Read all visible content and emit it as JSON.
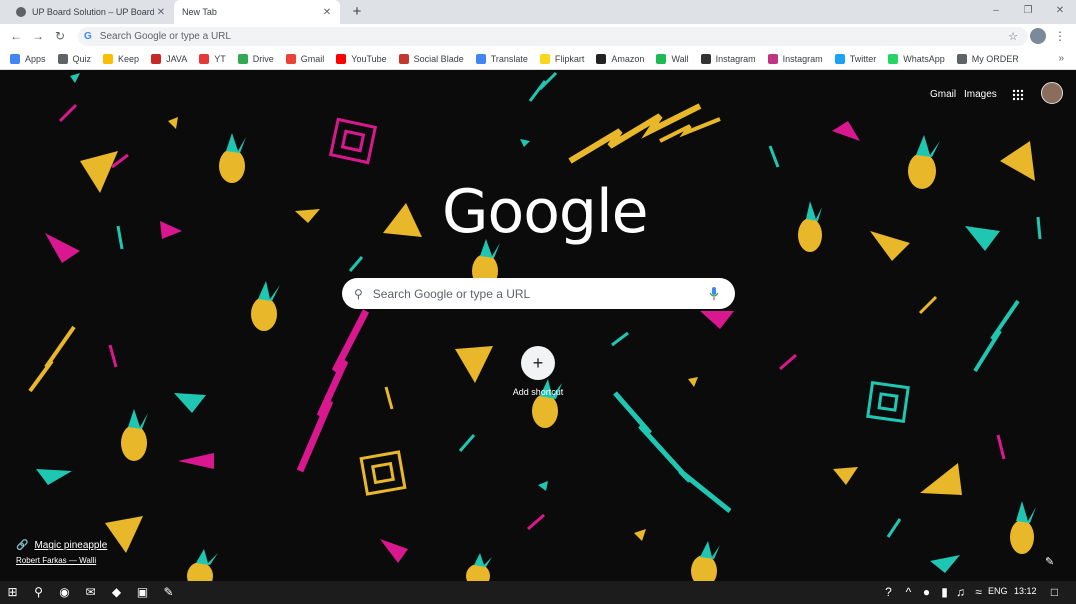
{
  "tabs": [
    {
      "title": "UP Board Solution – UP Board Te",
      "active": false
    },
    {
      "title": "New Tab",
      "active": true
    }
  ],
  "window_controls": {
    "minimize": "–",
    "maximize": "❐",
    "close": "✕"
  },
  "toolbar": {
    "back_icon": "←",
    "forward_icon": "→",
    "reload_icon": "↻",
    "omnibox_placeholder": "Search Google or type a URL",
    "star_icon": "☆",
    "menu_icon": "⋮"
  },
  "bookmarks": [
    {
      "label": "Apps",
      "color": "#4285f4"
    },
    {
      "label": "Quiz",
      "color": "#5f6368"
    },
    {
      "label": "Keep",
      "color": "#fbbc04"
    },
    {
      "label": "JAVA",
      "color": "#c62828"
    },
    {
      "label": "YT",
      "color": "#e53935"
    },
    {
      "label": "Drive",
      "color": "#34a853"
    },
    {
      "label": "Gmail",
      "color": "#ea4335"
    },
    {
      "label": "YouTube",
      "color": "#ff0000"
    },
    {
      "label": "Social Blade",
      "color": "#c0392b"
    },
    {
      "label": "Translate",
      "color": "#4285f4"
    },
    {
      "label": "Flipkart",
      "color": "#f9d71c"
    },
    {
      "label": "Amazon",
      "color": "#222222"
    },
    {
      "label": "Wall",
      "color": "#1db954"
    },
    {
      "label": "Instagram",
      "color": "#333333"
    },
    {
      "label": "Instagram",
      "color": "#c13584"
    },
    {
      "label": "Twitter",
      "color": "#1da1f2"
    },
    {
      "label": "WhatsApp",
      "color": "#25d366"
    },
    {
      "label": "My ORDER",
      "color": "#5f6368"
    }
  ],
  "bookmarks_more": "»",
  "ntp": {
    "gmail": "Gmail",
    "images": "Images",
    "apps_icon": "⋮⋮",
    "logo": "Google",
    "search_placeholder": "Search Google or type a URL",
    "add_shortcut_icon": "+",
    "add_shortcut_label": "Add shortcut",
    "attribution_title": "Magic pineapple",
    "attribution_author": "Robert Farkas — Walli",
    "customize_icon": "✎"
  },
  "taskbar": {
    "lang": "ENG",
    "time": "13:12"
  },
  "colors": {
    "yellow": "#e9b72a",
    "magenta": "#d9178f",
    "teal": "#1fc7b2"
  }
}
